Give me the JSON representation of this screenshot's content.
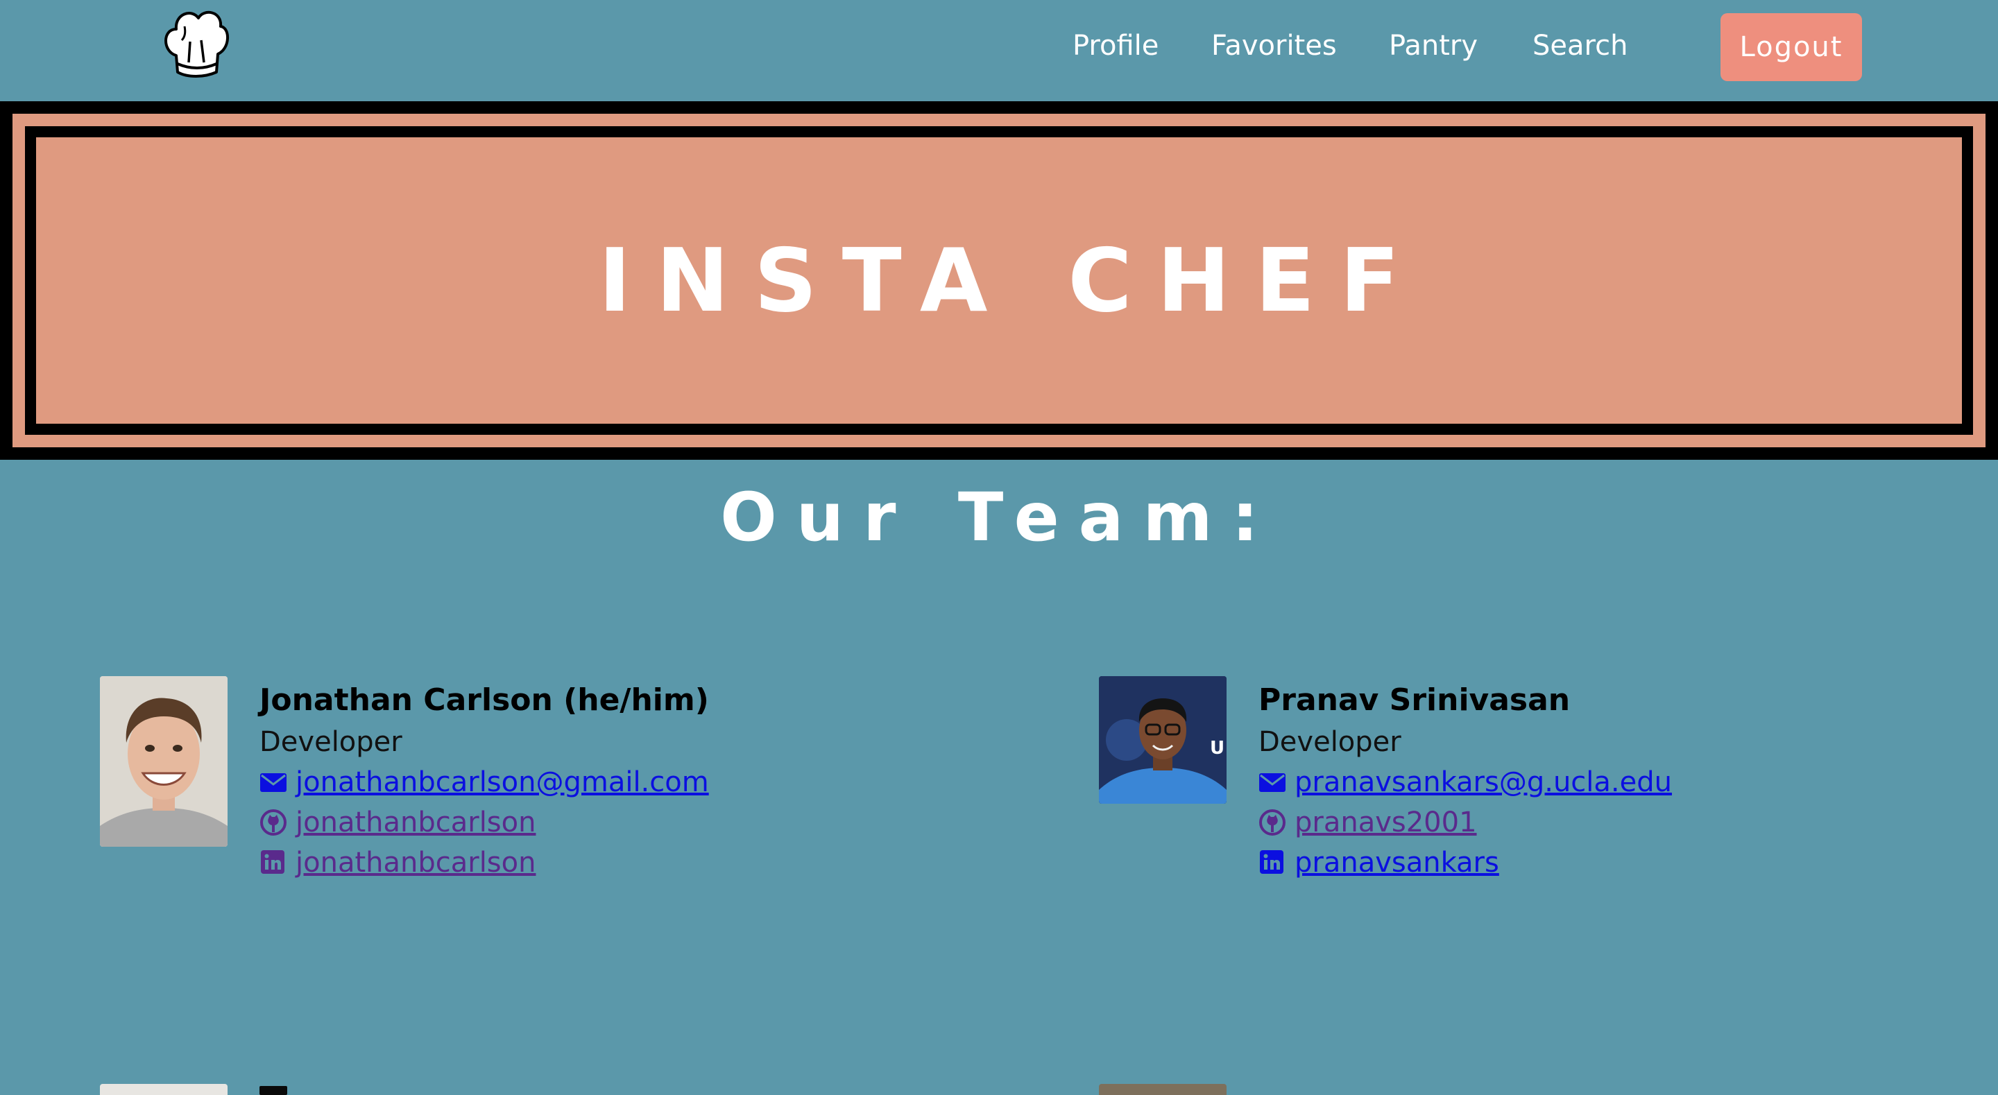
{
  "nav": {
    "logo_icon": "chef-hat-icon",
    "links": [
      {
        "label": "Profile"
      },
      {
        "label": "Favorites"
      },
      {
        "label": "Pantry"
      },
      {
        "label": "Search"
      }
    ],
    "logout_label": "Logout"
  },
  "banner": {
    "title": "INSTA CHEF"
  },
  "team": {
    "heading": "Our Team:",
    "members": [
      {
        "name": "Jonathan Carlson (he/him)",
        "role": "Developer",
        "email": "jonathanbcarlson@gmail.com",
        "github": "jonathanbcarlson",
        "linkedin": "jonathanbcarlson"
      },
      {
        "name": "Pranav Srinivasan",
        "role": "Developer",
        "email": "pranavsankars@g.ucla.edu",
        "github": "pranavs2001",
        "linkedin": "pranavsankars"
      }
    ]
  },
  "colors": {
    "background": "#5b98aa",
    "banner_fill": "#df9a80",
    "logout_button": "#ee8f7e",
    "link": "#0b0fe0",
    "visited_link": "#5a2a8c"
  }
}
